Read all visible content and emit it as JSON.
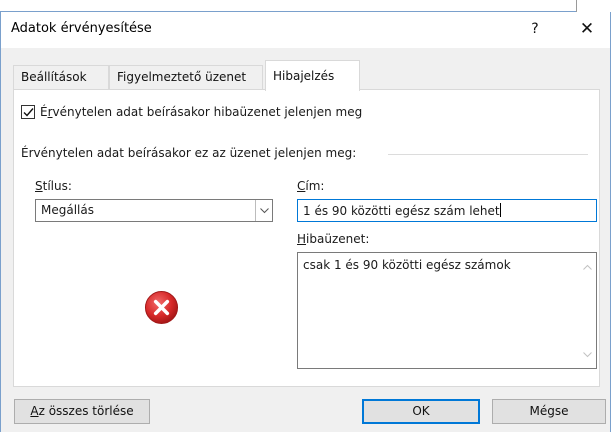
{
  "window": {
    "title": "Adatok érvényesítése",
    "help_glyph": "?",
    "close_glyph": "✕"
  },
  "tabs": [
    {
      "label": "Beállítások",
      "active": false
    },
    {
      "label": "Figyelmeztető üzenet",
      "active": false
    },
    {
      "label": "Hibajelzés",
      "active": true
    }
  ],
  "error_alert": {
    "show_error_checkbox": {
      "checked": true,
      "label_prefix": "É",
      "label_mnemonic": "r",
      "label_rest": "vénytelen adat beírásakor hibaüzenet jelenjen meg"
    },
    "group_label": "Érvénytelen adat beírásakor ez az üzenet jelenjen meg:",
    "style": {
      "label_mnemonic": "S",
      "label_rest": "tílus:",
      "value": "Megállás"
    },
    "title": {
      "label_mnemonic": "C",
      "label_rest": "ím:",
      "value": "1 és 90 közötti egész szám lehet"
    },
    "error_message": {
      "label_mnemonic": "H",
      "label_rest": "ibaüzenet:",
      "value": "csak 1 és 90 közötti egész számok"
    },
    "icon": "stop-error-icon"
  },
  "footer": {
    "clear_all": {
      "mnemonic": "A",
      "rest": "z összes törlése"
    },
    "ok_label": "OK",
    "cancel_label": "Mégse"
  },
  "colors": {
    "accent": "#0078d7",
    "error_red": "#d62828"
  }
}
